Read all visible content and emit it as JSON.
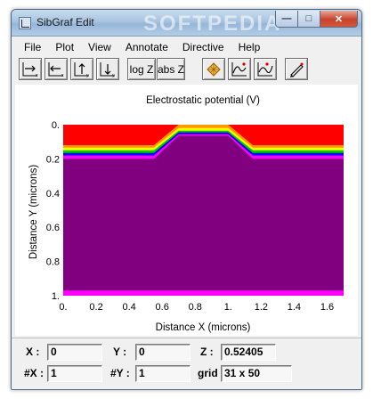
{
  "window": {
    "title": "SibGraf Edit",
    "watermark": "SOFTPEDIA",
    "minimize_glyph": "—",
    "maximize_glyph": "□",
    "close_glyph": "✕"
  },
  "menu": [
    "File",
    "Plot",
    "View",
    "Annotate",
    "Directive",
    "Help"
  ],
  "toolbar": {
    "buttons": [
      {
        "icon": "zoom-right-icon"
      },
      {
        "icon": "zoom-left-icon"
      },
      {
        "icon": "zoom-up-icon"
      },
      {
        "icon": "zoom-down-icon"
      },
      {
        "label": "log Z"
      },
      {
        "label": "abs Z"
      },
      {
        "icon": "grid-mesh-icon"
      },
      {
        "icon": "curve-tool-icon"
      },
      {
        "icon": "curve-tool-2-icon"
      },
      {
        "icon": "pencil-icon"
      }
    ]
  },
  "colors": {
    "band_red": "#ff0000",
    "band_orange": "#ff9900",
    "band_yellow": "#ffff00",
    "band_green": "#00cc00",
    "band_blue": "#0000ff",
    "band_magenta": "#ff00ff",
    "substrate": "#800080"
  },
  "chart_data": {
    "type": "heatmap",
    "title": "Electrostatic potential (V)",
    "xlabel": "Distance X (microns)",
    "ylabel": "Distance Y (microns)",
    "xlim": [
      0,
      1.7
    ],
    "ylim": [
      0,
      1.0
    ],
    "y_inverted": true,
    "x_ticks": [
      "0.",
      "0.2",
      "0.4",
      "0.6",
      "0.8",
      "1.",
      "1.2",
      "1.4",
      "1.6"
    ],
    "y_ticks": [
      "0.",
      "0.2",
      "0.4",
      "0.6",
      "0.8",
      "1."
    ],
    "x_tick_values": [
      0,
      0.2,
      0.4,
      0.6,
      0.8,
      1.0,
      1.2,
      1.4,
      1.6
    ],
    "y_tick_values": [
      0,
      0.2,
      0.4,
      0.6,
      0.8,
      1.0
    ],
    "structure": {
      "flat_depth_top": 0.12,
      "plateau_x": [
        0.7,
        1.0
      ],
      "slope_x": [
        [
          0.55,
          0.7
        ],
        [
          1.0,
          1.15
        ]
      ],
      "bands": [
        {
          "color": "#ff0000",
          "depth": 0.12,
          "plateau_depth": 0.0
        },
        {
          "color": "#ff9900",
          "depth": 0.135,
          "plateau_depth": 0.02
        },
        {
          "color": "#ffff00",
          "depth": 0.15,
          "plateau_depth": 0.035
        },
        {
          "color": "#00cc00",
          "depth": 0.165,
          "plateau_depth": 0.045
        },
        {
          "color": "#0000ff",
          "depth": 0.18,
          "plateau_depth": 0.055
        },
        {
          "color": "#ff00ff",
          "depth": 0.2,
          "plateau_depth": 0.065
        }
      ],
      "bottom_band_depth": 0.97
    }
  },
  "status": {
    "x_label": "X :",
    "x_value": "0",
    "y_label": "Y :",
    "y_value": "0",
    "z_label": "Z :",
    "z_value": "0.52405",
    "nx_label": "#X :",
    "nx_value": "1",
    "ny_label": "#Y :",
    "ny_value": "1",
    "grid_label": "grid",
    "grid_value": "31 x 50"
  }
}
